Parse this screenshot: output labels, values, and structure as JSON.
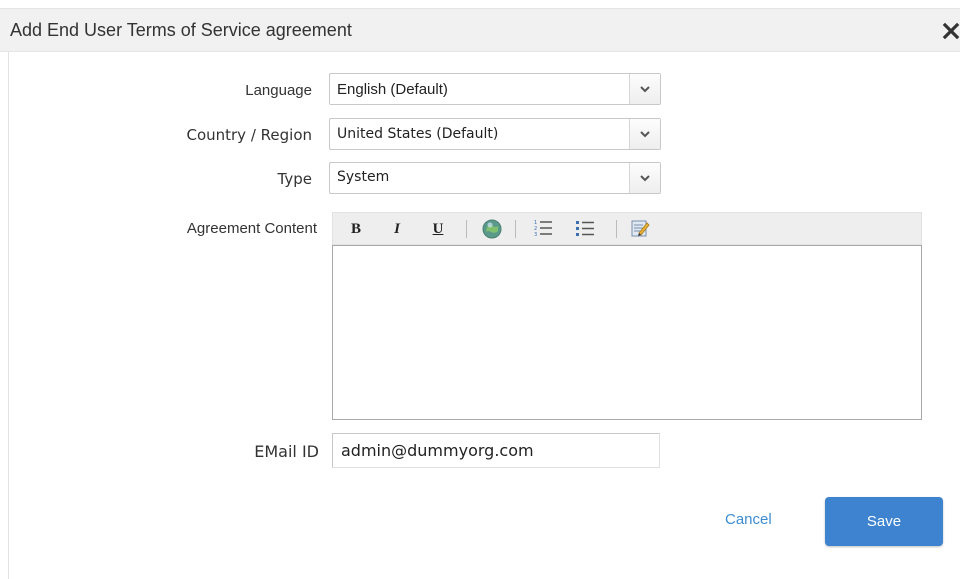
{
  "dialog": {
    "title": "Add End User Terms of Service agreement"
  },
  "form": {
    "language": {
      "label": "Language",
      "value": "English (Default)"
    },
    "country": {
      "label": "Country / Region",
      "value": "United States (Default)"
    },
    "type": {
      "label": "Type",
      "value": "System"
    },
    "agreement": {
      "label": "Agreement Content",
      "toolbar": {
        "bold": "B",
        "italic": "I",
        "underline": "U",
        "icons": [
          "bold-icon",
          "italic-icon",
          "underline-icon",
          "insert-link-globe-icon",
          "numbered-list-icon",
          "bulleted-list-icon",
          "edit-source-icon"
        ]
      },
      "content": ""
    },
    "email": {
      "label": "EMail ID",
      "value": "admin@dummyorg.com"
    }
  },
  "actions": {
    "cancel": "Cancel",
    "save": "Save"
  },
  "colors": {
    "accent": "#3d83d0",
    "link": "#3c8dd0",
    "titlebar": "#f1f1f1"
  }
}
